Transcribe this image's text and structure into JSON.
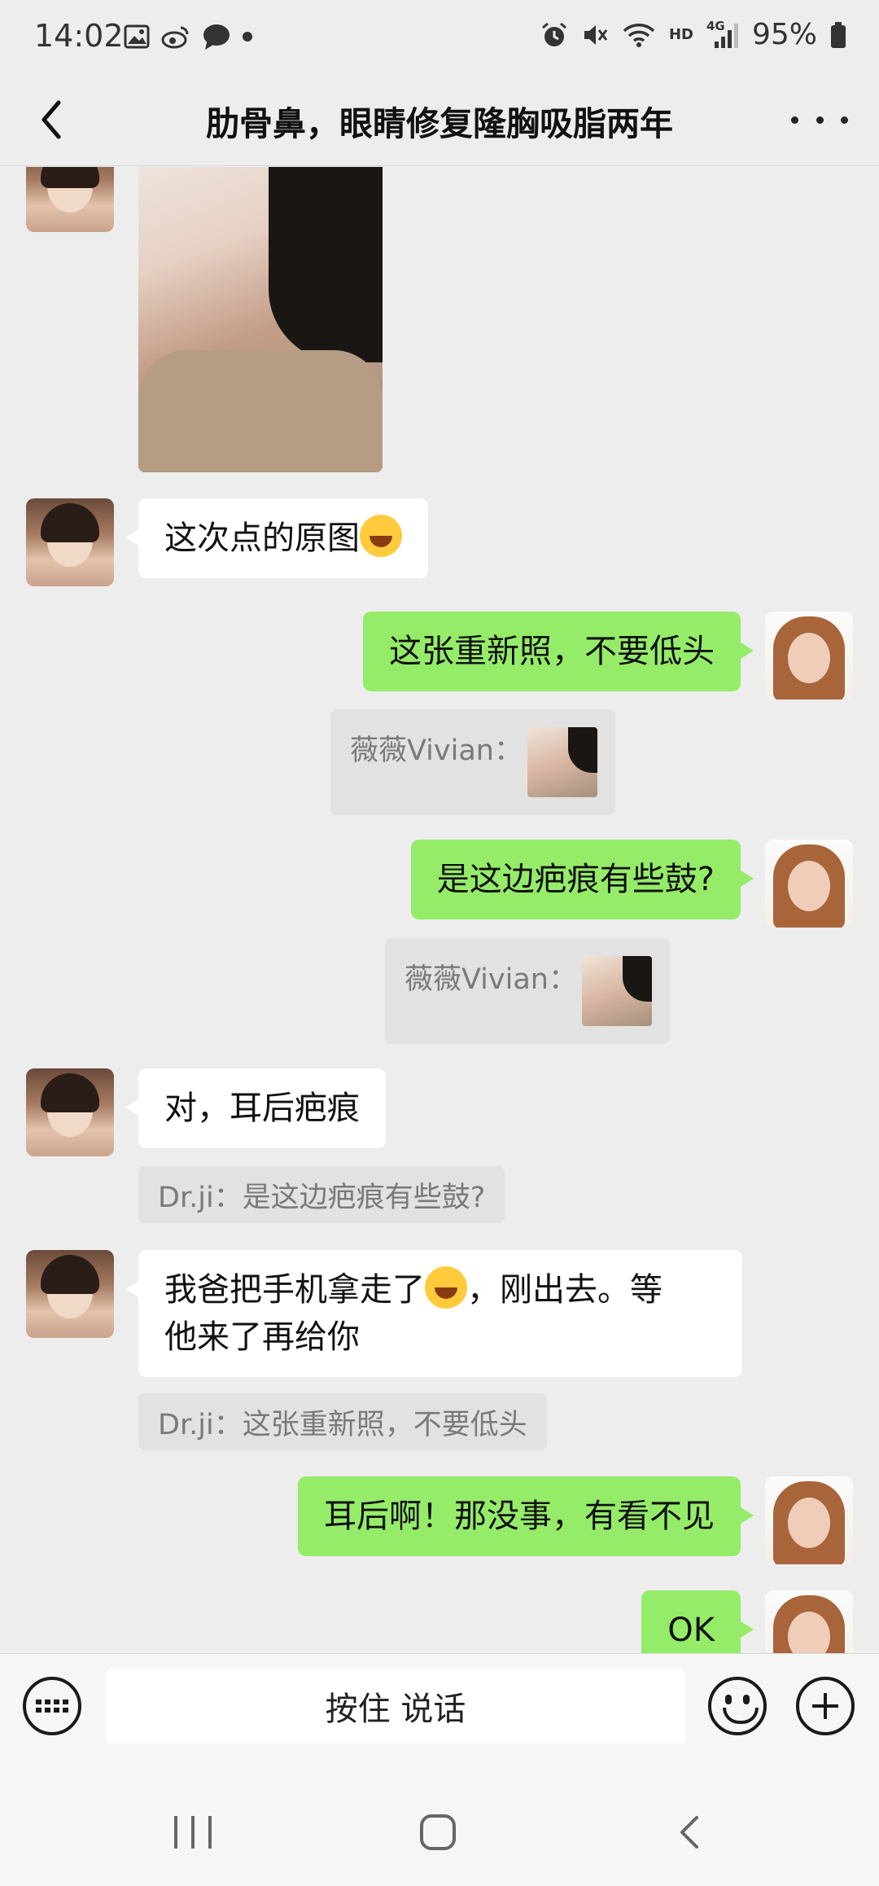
{
  "status_bar": {
    "time": "14:02",
    "network": "HD",
    "network_type": "4G",
    "battery": "95%"
  },
  "header": {
    "title": "肋骨鼻，眼睛修复隆胸吸脂两年"
  },
  "messages": [
    {
      "side": "left",
      "type": "image",
      "avatar": "contact-avatar"
    },
    {
      "side": "left",
      "type": "text",
      "text": "这次点的原图",
      "emoji": "laughing-tears-emoji"
    },
    {
      "side": "right",
      "type": "text",
      "text": "这张重新照，不要低头",
      "quote": {
        "sender": "薇薇Vivian：",
        "kind": "image"
      }
    },
    {
      "side": "right",
      "type": "text",
      "text": "是这边疤痕有些鼓?",
      "quote": {
        "sender": "薇薇Vivian：",
        "kind": "image"
      }
    },
    {
      "side": "left",
      "type": "text",
      "text": "对，耳后疤痕",
      "quote": {
        "text": "Dr.ji：是这边疤痕有些鼓?"
      }
    },
    {
      "side": "left",
      "type": "text",
      "text_1": "我爸把手机拿走了",
      "emoji": "crying-emoji",
      "text_2": "，刚出去。等",
      "text_3": "他来了再给你",
      "quote": {
        "text": "Dr.ji：这张重新照，不要低头"
      }
    },
    {
      "side": "right",
      "type": "text",
      "text": "耳后啊！那没事，有看不见"
    },
    {
      "side": "right",
      "type": "text",
      "text": "OK"
    }
  ],
  "input_bar": {
    "voice_label": "按住 说话"
  },
  "colors": {
    "background": "#ededed",
    "self_bubble": "#95ec69",
    "other_bubble": "#ffffff",
    "quote_bg": "#e2e2e2"
  }
}
